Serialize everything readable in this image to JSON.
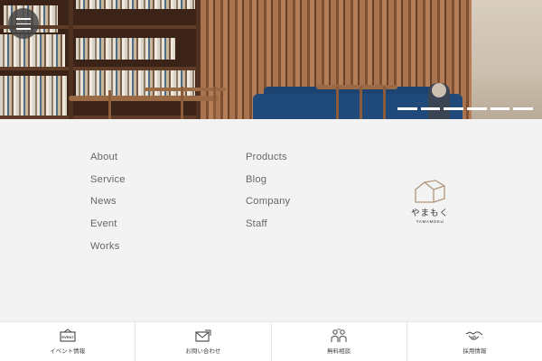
{
  "hero": {
    "menu_icon": "hamburger-icon",
    "slide_count": 6,
    "active_slide": 1
  },
  "footer_nav": {
    "column1": [
      "About",
      "Service",
      "News",
      "Event",
      "Works"
    ],
    "column2": [
      "Products",
      "Blog",
      "Company",
      "Staff"
    ]
  },
  "logo": {
    "jp": "やまもく",
    "en": "YAMAMOKU"
  },
  "bottom_bar": {
    "items": [
      {
        "label": "イベント情報",
        "icon": "event-board-icon",
        "icon_text": "EVENT"
      },
      {
        "label": "お問い合わせ",
        "icon": "mail-icon"
      },
      {
        "label": "無料相談",
        "icon": "consultation-icon"
      },
      {
        "label": "採用情報",
        "icon": "handshake-icon"
      }
    ]
  },
  "colors": {
    "background": "#f3f3f3",
    "nav_text": "#666666",
    "logo_stroke": "#b0967a"
  }
}
